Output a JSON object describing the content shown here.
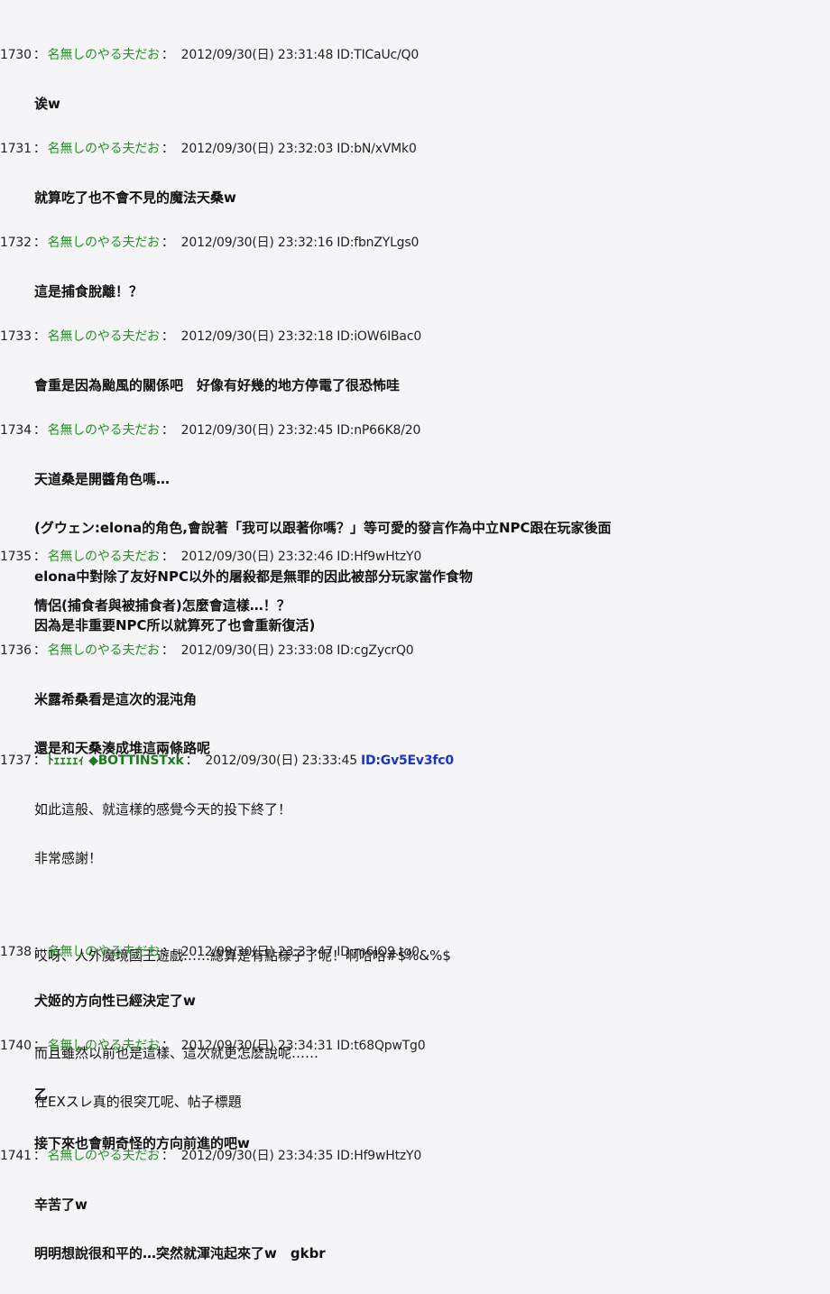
{
  "colors": {
    "background": "#f5f5f7",
    "name_green": "#2a8f2a",
    "highlight_id_blue": "#1a33cc"
  },
  "posts": [
    {
      "number": "1730",
      "name": "名無しのやる夫だお",
      "date": "2012/09/30(日) 23:31:48",
      "id": "ID:TICaUc/Q0",
      "lines": [
        "诶w"
      ]
    },
    {
      "number": "1731",
      "name": "名無しのやる夫だお",
      "date": "2012/09/30(日) 23:32:03",
      "id": "ID:bN/xVMk0",
      "lines": [
        "就算吃了也不會不見的魔法天桑w"
      ]
    },
    {
      "number": "1732",
      "name": "名無しのやる夫だお",
      "date": "2012/09/30(日) 23:32:16",
      "id": "ID:fbnZYLgs0",
      "lines": [
        "這是捕食脫離！？"
      ]
    },
    {
      "number": "1733",
      "name": "名無しのやる夫だお",
      "date": "2012/09/30(日) 23:32:18",
      "id": "ID:iOW6IBac0",
      "lines": [
        "會重是因為颱風的關係吧　好像有好幾的地方停電了很恐怖哇"
      ]
    },
    {
      "number": "1734",
      "name": "名無しのやる夫だお",
      "date": "2012/09/30(日) 23:32:45",
      "id": "ID:nP66K8/20",
      "lines": [
        "天道桑是開醬角色嗎…",
        "(グウェン:elona的角色,會說著「我可以跟著你嗎？」等可愛的發言作為中立NPC跟在玩家後面",
        "elona中對除了友好NPC以外的屠殺都是無罪的因此被部分玩家當作食物",
        "因為是非重要NPC所以就算死了也會重新復活)"
      ]
    },
    {
      "number": "1735",
      "name": "名無しのやる夫だお",
      "date": "2012/09/30(日) 23:32:46",
      "id": "ID:Hf9wHtzY0",
      "lines": [
        "情侶(捕食者與被捕食者)怎麼會這樣…！？"
      ]
    },
    {
      "number": "1736",
      "name": "名無しのやる夫だお",
      "date": "2012/09/30(日) 23:33:08",
      "id": "ID:cgZycrQ0",
      "lines": [
        "米露希桑看是這次的混沌角",
        "還是和天桑湊成堆這兩條路呢"
      ]
    },
    {
      "number": "1737",
      "name": "ﾄｪｪｪｪｨ ◆BOTTINSTxk",
      "date": "2012/09/30(日) 23:33:45",
      "id": "ID:Gv5Ev3fc0",
      "lines": [
        "如此這般、就這樣的感覺今天的投下終了！",
        "非常感謝！",
        "",
        "哎呀、人外魔境國王遊戲……總算是有點樣子了呢！啊哈哈#$%&%$",
        "",
        "而且雖然以前也是這樣、這次就更怎麽說呢……",
        "在EXスレ真的很突兀呢、帖子標題"
      ]
    },
    {
      "number": "1738",
      "name": "名無しのやる夫だお",
      "date": "2012/09/30(日) 23:33:47",
      "id": "ID:m6IQ9.tg0",
      "lines": [
        "犬姬的方向性已經決定了w"
      ]
    },
    {
      "number": "1740",
      "name": "名無しのやる夫だお",
      "date": "2012/09/30(日) 23:34:31",
      "id": "ID:t68QpwTg0",
      "lines": [
        "乙",
        "接下來也會朝奇怪的方向前進的吧w"
      ]
    },
    {
      "number": "1741",
      "name": "名無しのやる夫だお",
      "date": "2012/09/30(日) 23:34:35",
      "id": "ID:Hf9wHtzY0",
      "lines": [
        "辛苦了w",
        "明明想說很和平的…突然就渾沌起來了w　gkbr"
      ]
    }
  ]
}
